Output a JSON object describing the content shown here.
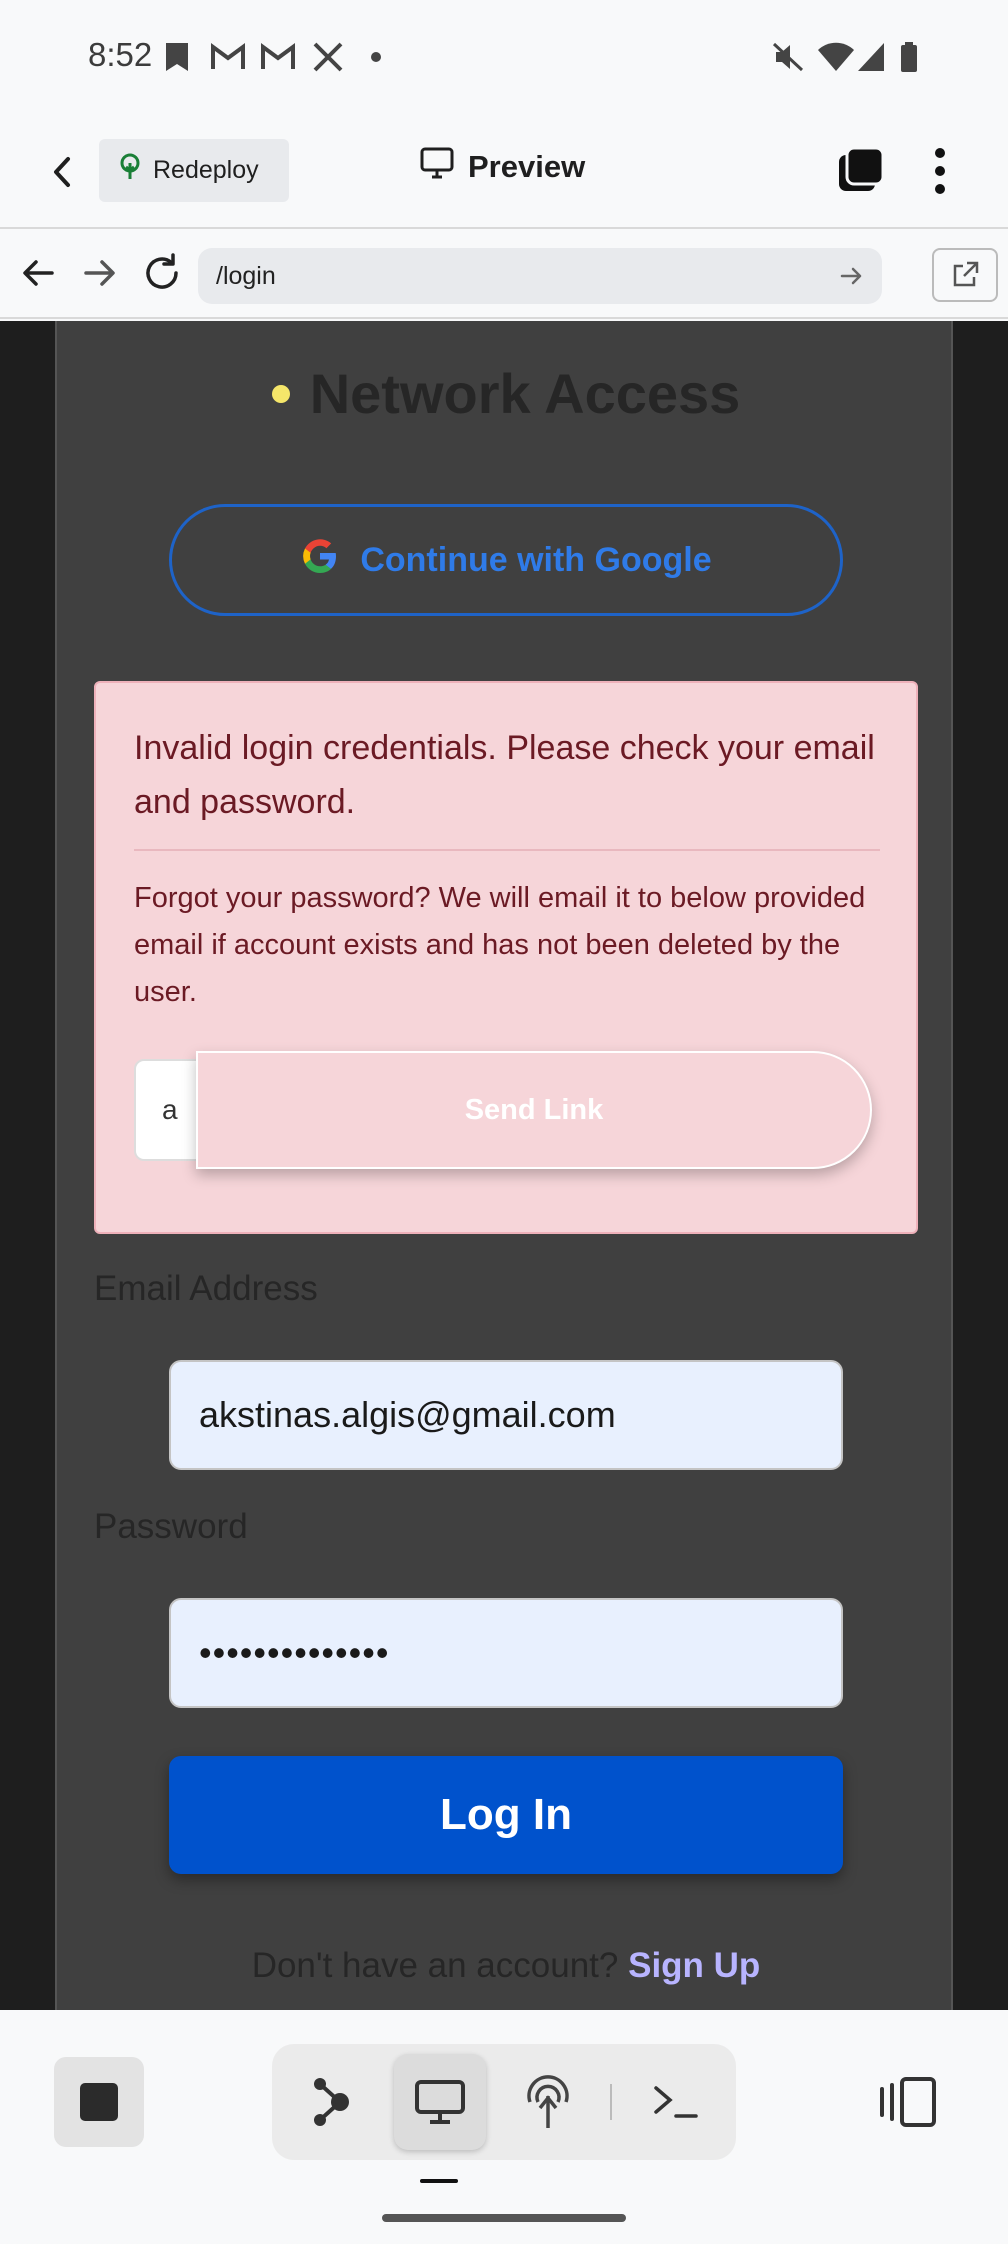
{
  "status_bar": {
    "time": "8:52",
    "icons": [
      "bookmark-icon",
      "gmail-icon",
      "gmail-icon",
      "x-icon",
      "dot-icon",
      "mute-icon",
      "wifi-icon",
      "signal-icon",
      "battery-icon"
    ]
  },
  "toolbar": {
    "redeploy_label": "Redeploy",
    "preview_label": "Preview"
  },
  "browser": {
    "url": "/login"
  },
  "login": {
    "title": "Network Access",
    "google_button": "Continue with Google",
    "error_message": "Invalid login credentials. Please check your email and password.",
    "forgot_message": "Forgot your password? We will email it to below provided email if account exists and has not been deleted by the user.",
    "reset_email_value": "a",
    "send_link_label": "Send Link",
    "email_label": "Email Address",
    "email_value": "akstinas.algis@gmail.com",
    "password_label": "Password",
    "password_value": "••••••••••••••",
    "login_button": "Log In",
    "signup_prompt": "Don't have an account?",
    "signup_link": "Sign Up"
  },
  "colors": {
    "accent_blue": "#0052cc",
    "error_bg": "#f6d5d9",
    "card_bg": "#404040",
    "title_dot": "#f5e66a"
  }
}
